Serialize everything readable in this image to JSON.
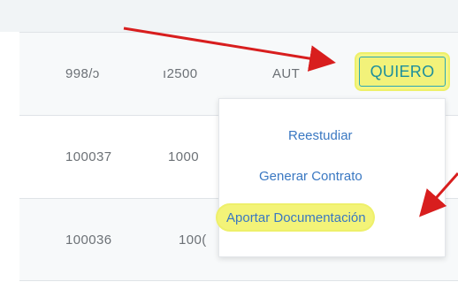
{
  "rows": [
    {
      "id": "998/ɔ",
      "amount": "ı2500",
      "status": "AUT",
      "action": "QUIERO"
    },
    {
      "id": "100037",
      "amount": "1000"
    },
    {
      "id": "100036",
      "amount": "100("
    }
  ],
  "menu": {
    "items": [
      {
        "label": "Reestudiar"
      },
      {
        "label": "Generar Contrato"
      },
      {
        "label": "Aportar Documentación"
      }
    ]
  },
  "colors": {
    "highlight": "#f3f378",
    "annotation_arrow": "#d81e1e",
    "link": "#3a78c2",
    "button_text": "#1d8f9c"
  }
}
